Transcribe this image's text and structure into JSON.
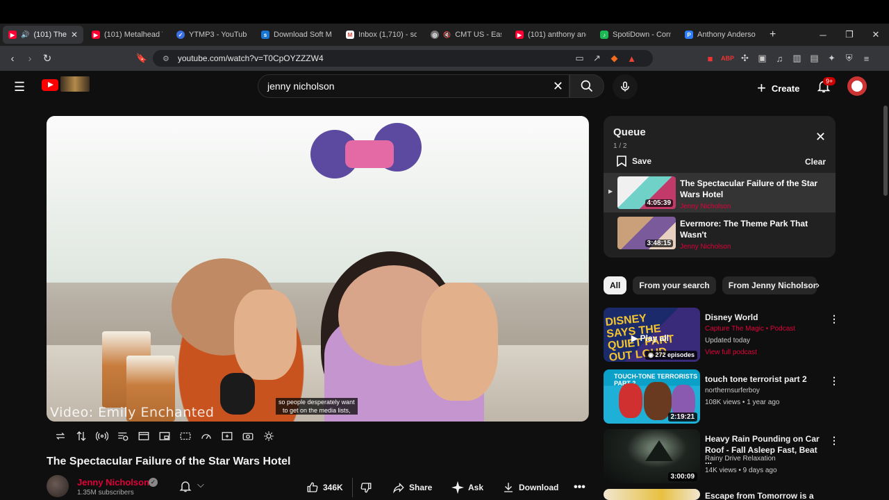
{
  "browser": {
    "tabs": [
      {
        "title": "(101) The S",
        "favicon": "youtube",
        "color": "#ff0033",
        "active": true,
        "audio": true
      },
      {
        "title": "(101) Metalhead T",
        "favicon": "youtube",
        "color": "#ff0033"
      },
      {
        "title": "YTMP3 - YouTube",
        "favicon": "check",
        "color": "#3b6fe0"
      },
      {
        "title": "Download Soft M",
        "favicon": "sf",
        "color": "#1976d2"
      },
      {
        "title": "Inbox (1,710) - sdi",
        "favicon": "gmail",
        "color": "#ea4335"
      },
      {
        "title": "CMT US - East",
        "favicon": "globe",
        "color": "#888888"
      },
      {
        "title": "(101) anthony and",
        "favicon": "youtube",
        "color": "#ff0033"
      },
      {
        "title": "SpotiDown - Conv",
        "favicon": "note",
        "color": "#1db954"
      },
      {
        "title": "Anthony Anderson",
        "favicon": "p",
        "color": "#2e7cf6"
      }
    ],
    "new_tab": "+",
    "url": "youtube.com/watch?v=T0CpOYZZZW4"
  },
  "header": {
    "search_value": "jenny nicholson",
    "create_label": "Create",
    "notifications": "9+"
  },
  "video": {
    "title": "The Spectacular Failure of the Star Wars Hotel",
    "watermark": "Video: Emily Enchanted",
    "caption_line1": "so people desperately want",
    "caption_line2": "to get on the media lists,",
    "channel": "Jenny Nicholson",
    "subscribers": "1.35M subscribers",
    "likes": "346K",
    "share_label": "Share",
    "ask_label": "Ask",
    "download_label": "Download"
  },
  "queue": {
    "title": "Queue",
    "count": "1 / 2",
    "save_label": "Save",
    "clear_label": "Clear",
    "items": [
      {
        "title": "The Spectacular Failure of the Star Wars Hotel",
        "channel": "Jenny Nicholson",
        "duration": "4:05:39"
      },
      {
        "title": "Evermore: The Theme Park That Wasn't",
        "channel": "Jenny Nicholson",
        "duration": "3:48:15"
      }
    ]
  },
  "chips": [
    "All",
    "From your search",
    "From Jenny Nicholson"
  ],
  "recommendations": [
    {
      "title": "Disney World",
      "channel": "Capture The Magic",
      "tag": "Podcast",
      "meta": "Updated today",
      "extra": "View full podcast",
      "overlay": "Play all",
      "episodes": "272 episodes"
    },
    {
      "title": "touch tone terrorist part 2",
      "channel": "northernsurferboy",
      "meta": "108K views • 1 year ago",
      "duration": "2:19:21"
    },
    {
      "title": "Heavy Rain Pounding on Car Roof - Fall Asleep Fast, Beat ...",
      "channel": "Rainy Drive Relaxation",
      "meta": "14K views • 9 days ago",
      "duration": "3:00:09"
    },
    {
      "title": "Escape from Tomorrow is a"
    }
  ]
}
